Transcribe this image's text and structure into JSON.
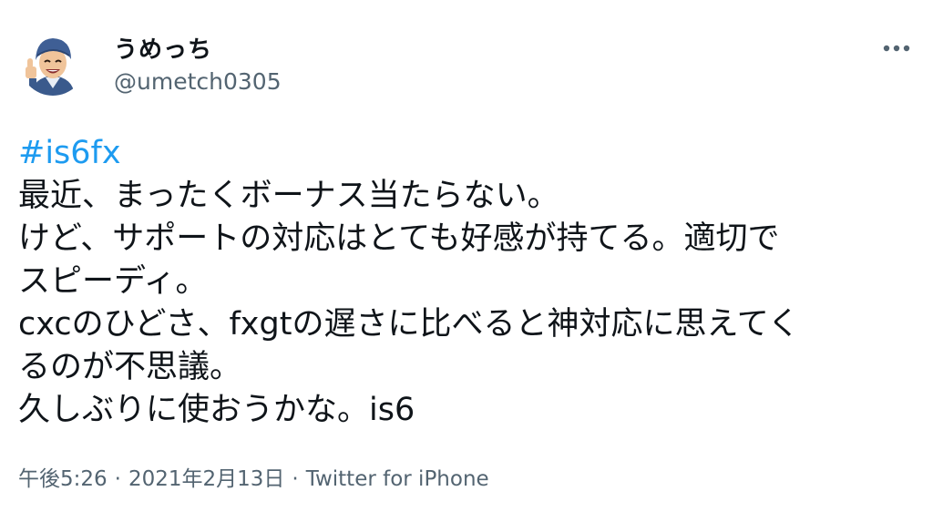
{
  "tweet": {
    "display_name": "うめっち",
    "handle": "@umetch0305",
    "hashtag": "#is6fx",
    "lines": [
      "最近、まったくボーナス当たらない。",
      "けど、サポートの対応はとても好感が持てる。適切で",
      "スピーディ。",
      "cxcのひどさ、fxgtの遅さに比べると神対応に思えてく",
      "るのが不思議。",
      "久しぶりに使おうかな。is6"
    ],
    "time": "午後5:26",
    "date": "2021年2月13日",
    "source": "Twitter for iPhone",
    "separator": "·"
  },
  "icons": {
    "more": "more-horizontal-icon",
    "avatar": "avatar"
  },
  "colors": {
    "link": "#1d9bf0",
    "text": "#0f1419",
    "secondary": "#536471"
  }
}
